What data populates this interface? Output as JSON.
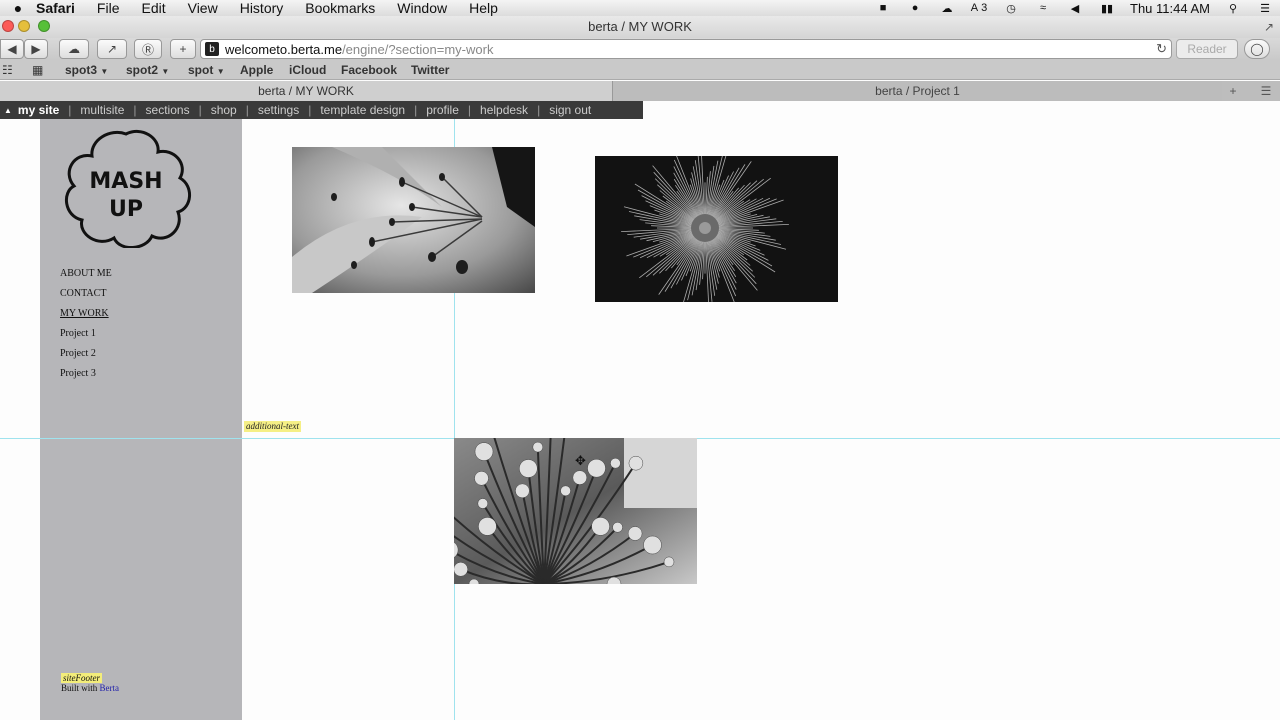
{
  "menubar": {
    "app": "Safari",
    "menus": [
      "File",
      "Edit",
      "View",
      "History",
      "Bookmarks",
      "Window",
      "Help"
    ],
    "status_battery_count": "3",
    "clock": "Thu 11:44 AM"
  },
  "window": {
    "title": "berta / MY WORK"
  },
  "toolbar": {
    "url_host": "welcometo.berta.me",
    "url_path": "/engine/?section=my-work",
    "favicon_letter": "b",
    "reader_label": "Reader"
  },
  "bookmarks": [
    {
      "label": "spot3",
      "dropdown": true
    },
    {
      "label": "spot2",
      "dropdown": true
    },
    {
      "label": "spot",
      "dropdown": true
    },
    {
      "label": "Apple",
      "dropdown": false
    },
    {
      "label": "iCloud",
      "dropdown": false
    },
    {
      "label": "Facebook",
      "dropdown": false
    },
    {
      "label": "Twitter",
      "dropdown": false
    }
  ],
  "tabs": [
    {
      "label": "berta / MY WORK",
      "active": true
    },
    {
      "label": "berta / Project 1",
      "active": false
    }
  ],
  "admin_menu": [
    "my site",
    "multisite",
    "sections",
    "shop",
    "settings",
    "template design",
    "profile",
    "helpdesk",
    "sign out"
  ],
  "site": {
    "logo_line1": "MASH",
    "logo_line2": "UP",
    "nav": [
      "ABOUT ME",
      "CONTACT",
      "MY WORK",
      "Project 1",
      "Project 2",
      "Project 3"
    ],
    "current_nav": "MY WORK",
    "additional_text": "additional-text",
    "footer_tag": "siteFooter",
    "footer_text": "Built with",
    "footer_link": "Berta"
  },
  "photos": [
    {
      "subject": "lily-flower-closeup"
    },
    {
      "subject": "dandelion-seed-head"
    },
    {
      "subject": "allium-flower-head"
    }
  ],
  "colors": {
    "sidebar": "#b6b6b9",
    "admin_bar": "#3a3a3a",
    "guide_line": "#9fe3ee",
    "highlight": "#f5ef86"
  }
}
